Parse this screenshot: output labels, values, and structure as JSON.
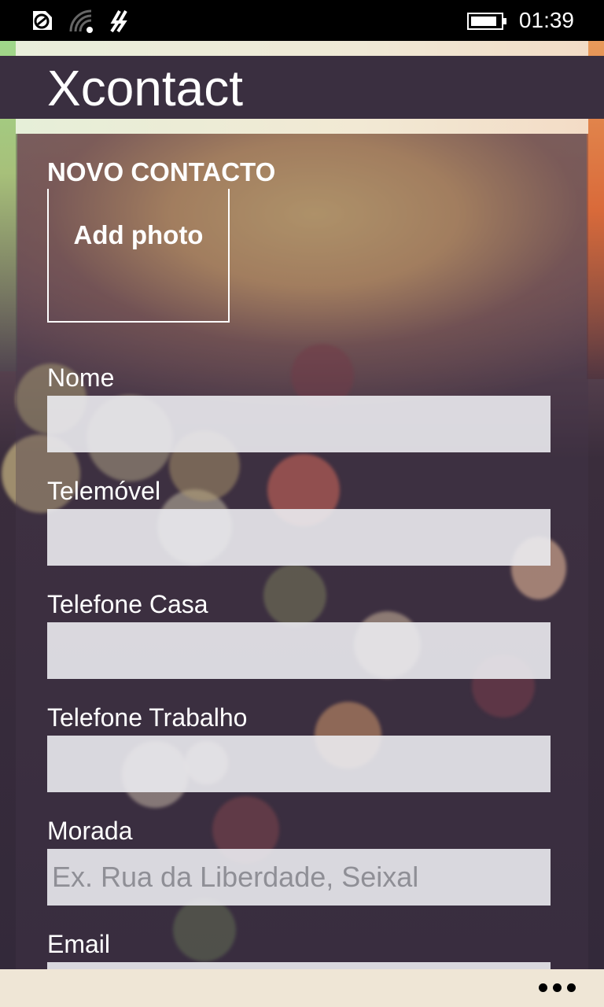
{
  "status_bar": {
    "time": "01:39",
    "icons": [
      "sync-icon",
      "wifi-icon",
      "data-connection-icon",
      "battery-icon"
    ]
  },
  "app": {
    "title": "Xcontact"
  },
  "form": {
    "section_title": "NOVO CONTACTO",
    "photo_label": "Add photo",
    "fields": [
      {
        "label": "Nome",
        "value": "",
        "placeholder": ""
      },
      {
        "label": "Telemóvel",
        "value": "",
        "placeholder": ""
      },
      {
        "label": "Telefone Casa",
        "value": "",
        "placeholder": ""
      },
      {
        "label": "Telefone Trabalho",
        "value": "",
        "placeholder": ""
      },
      {
        "label": "Morada",
        "value": "",
        "placeholder": "Ex. Rua da Liberdade, Seixal"
      },
      {
        "label": "Email",
        "value": "",
        "placeholder": ""
      }
    ]
  },
  "app_bar": {
    "more_icon": "more-dots-icon"
  }
}
